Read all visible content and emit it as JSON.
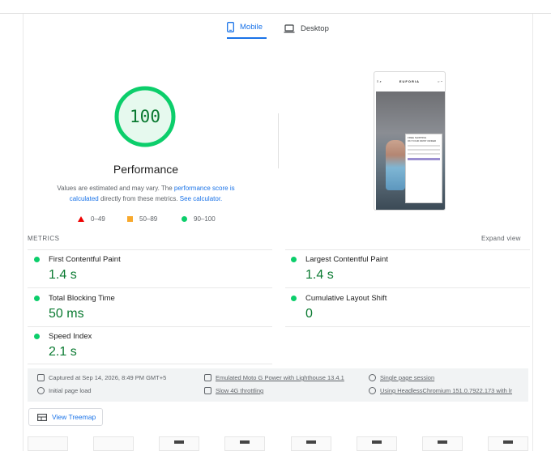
{
  "tabs": [
    {
      "label": "Mobile",
      "active": true,
      "icon": "smartphone-icon"
    },
    {
      "label": "Desktop",
      "active": false,
      "icon": "laptop-icon"
    }
  ],
  "score": {
    "value": "100",
    "category": "Performance",
    "note_prefix": "Values are estimated and may vary. The ",
    "note_link1": "performance score is calculated",
    "note_mid": " directly from these metrics. ",
    "note_link2": "See calculator."
  },
  "legend": [
    {
      "shape": "triangle",
      "range": "0–49",
      "color": "#ee0000"
    },
    {
      "shape": "square",
      "range": "50–89",
      "color": "#f8a92d"
    },
    {
      "shape": "circle",
      "range": "90–100",
      "color": "#0cce6b"
    }
  ],
  "screenshot": {
    "brand": "EUFORIA",
    "modal_title": "FREE SHIPPING",
    "modal_sub": "ON YOUR FIRST ORDER"
  },
  "metrics": {
    "header": "METRICS",
    "expand_label": "Expand view",
    "items": [
      {
        "name": "First Contentful Paint",
        "value": "1.4 s"
      },
      {
        "name": "Largest Contentful Paint",
        "value": "1.4 s"
      },
      {
        "name": "Total Blocking Time",
        "value": "50 ms"
      },
      {
        "name": "Cumulative Layout Shift",
        "value": "0"
      },
      {
        "name": "Speed Index",
        "value": "2.1 s"
      }
    ]
  },
  "runtime": {
    "captured": "Captured at Sep 14, 2026, 8:49 PM GMT+5",
    "initial_load": "Initial page load",
    "device": "Emulated Moto G Power with Lighthouse 13.4.1",
    "throttling": "Slow 4G throttling",
    "session": "Single page session",
    "browser": "Using HeadlessChromium 151.0.7922.173 with lr"
  },
  "treemap_label": "View Treemap",
  "colors": {
    "pass": "#0cce6b",
    "pass_text": "#0a7a31",
    "link": "#1a73e8"
  }
}
